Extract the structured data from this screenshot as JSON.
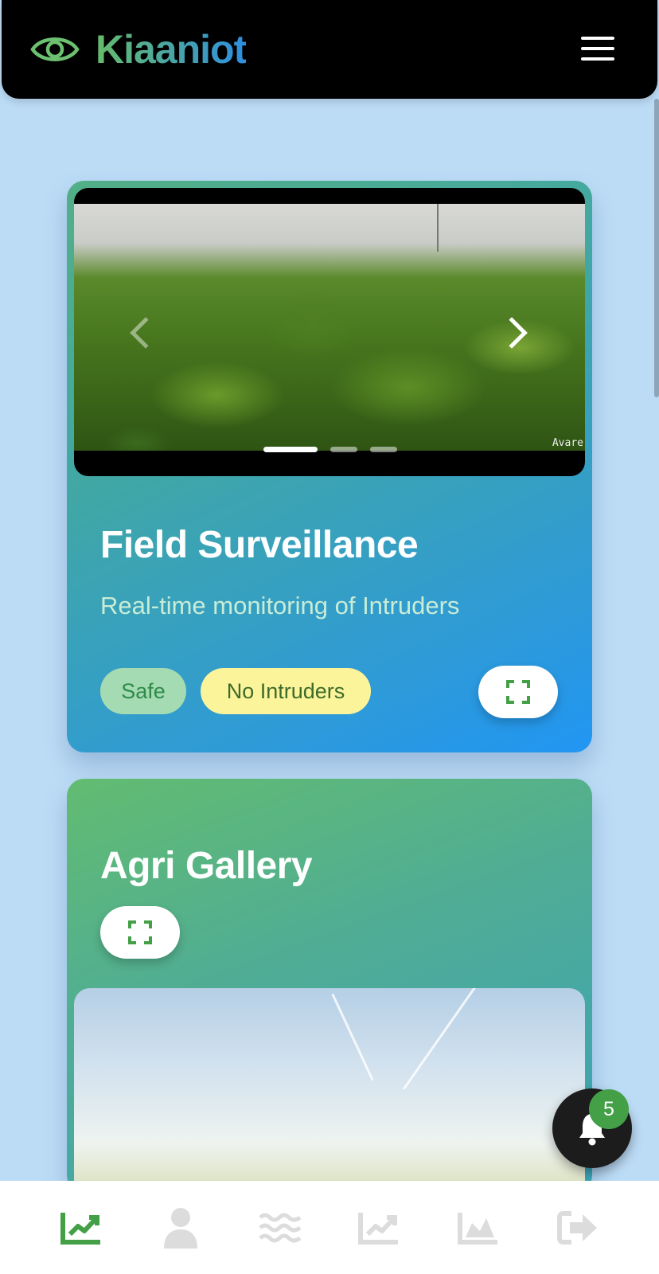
{
  "app": {
    "brand_name": "Kiaaniot",
    "accent_green": "#43a047",
    "accent_blue": "#2196f3"
  },
  "header": {
    "logo_icon": "eye-icon",
    "menu_icon": "hamburger-menu-icon"
  },
  "surveillance_card": {
    "title": "Field Surveillance",
    "subtitle": "Real-time monitoring of Intruders",
    "status_badge": "Safe",
    "intruder_badge": "No Intruders",
    "expand_icon": "fullscreen-icon",
    "carousel": {
      "slide_count": 3,
      "active_slide": 1,
      "image_watermark": "Avare",
      "prev_icon": "chevron-left-icon",
      "next_icon": "chevron-right-icon"
    }
  },
  "gallery_card": {
    "title": "Agri Gallery",
    "expand_icon": "fullscreen-icon"
  },
  "notifications": {
    "count": "5",
    "icon": "bell-icon"
  },
  "bottom_nav": {
    "items": [
      {
        "icon": "chart-line-icon",
        "active": true
      },
      {
        "icon": "user-icon",
        "active": false
      },
      {
        "icon": "water-waves-icon",
        "active": false
      },
      {
        "icon": "chart-trend-icon",
        "active": false
      },
      {
        "icon": "area-chart-icon",
        "active": false
      },
      {
        "icon": "logout-icon",
        "active": false
      }
    ]
  }
}
